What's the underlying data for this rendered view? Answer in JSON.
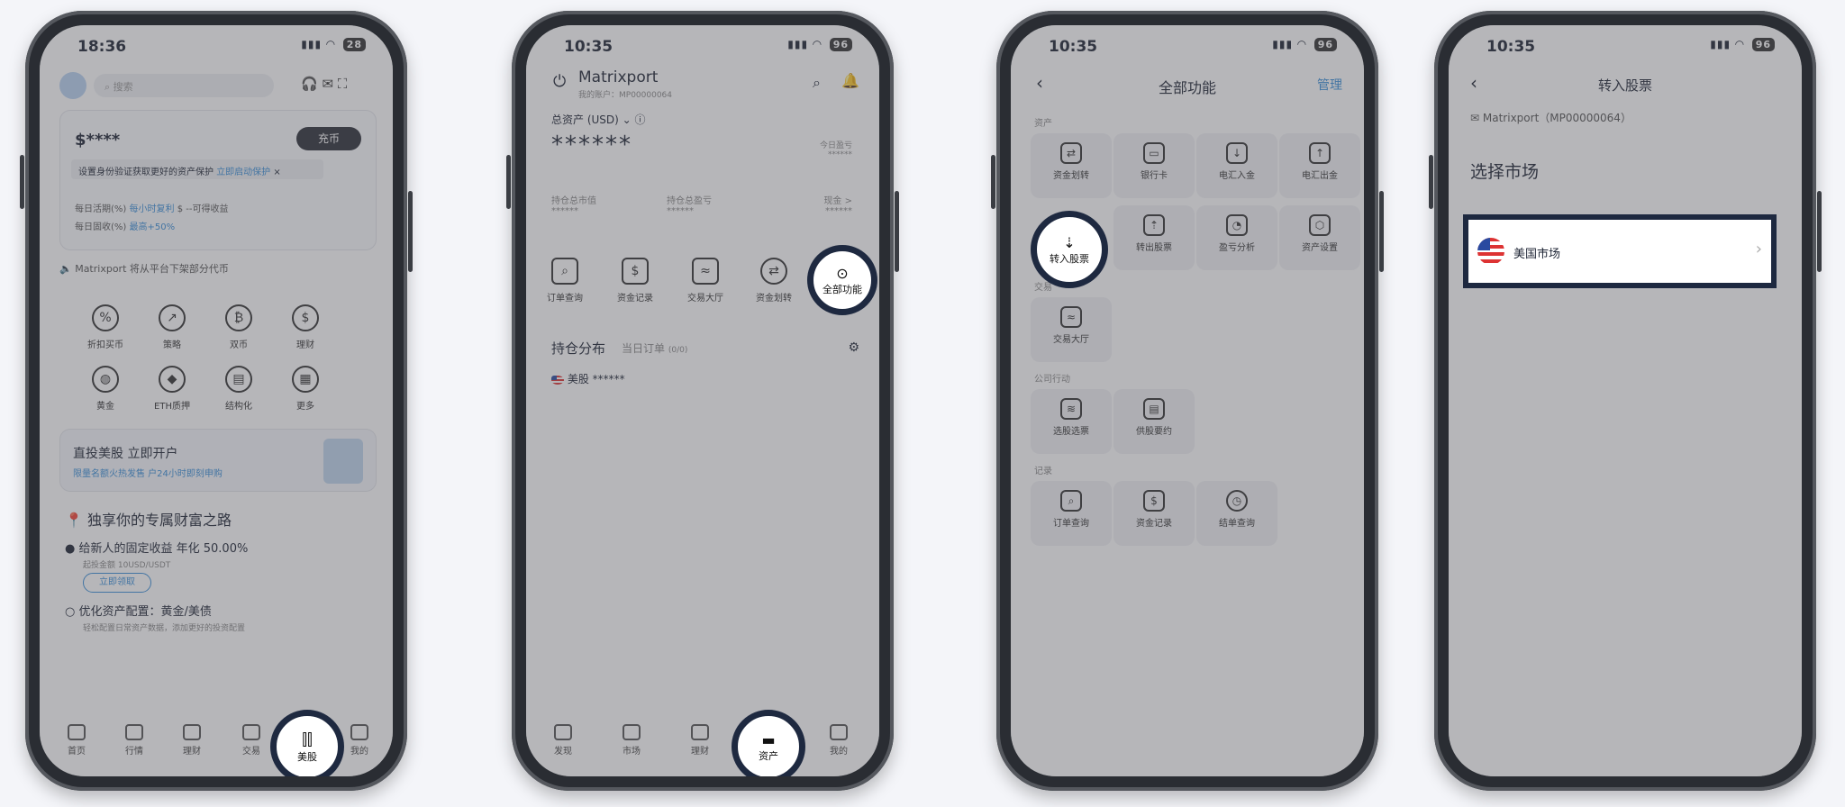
{
  "phone1": {
    "time": "18:36",
    "battery": "28",
    "search_placeholder": "搜索",
    "balance": "$****",
    "deposit": "充币",
    "kyc_text": "设置身份验证获取更好的资产保护",
    "kyc_link": "立即启动保护",
    "daily": "每日活期(%)",
    "daily_link": "每小时复利",
    "daily_tail": "$ --可得收益",
    "daily_period": "每日固收(%)",
    "daily_period_link": "最高+50%",
    "notice": "Matrixport 将从平台下架部分代币",
    "icons": [
      "折扣买币",
      "策略",
      "双币",
      "理财",
      "黄金",
      "ETH质押",
      "结构化",
      "更多"
    ],
    "banner_title": "直投美股 立即开户",
    "banner_sub": "限量名额火热发售 户24小时即刻申购",
    "journey_title": "独享你的专属财富之路",
    "step1": "给新人的固定收益 年化 50.00%",
    "step1_sub": "起投金额 10USD/USDT",
    "step1_btn": "立即领取",
    "step2": "优化资产配置：黄金/美债",
    "step2_sub": "轻松配置日常资产数据，添加更好的投资配置",
    "tabs": [
      "首页",
      "行情",
      "理财",
      "交易",
      "我的"
    ],
    "highlight_tab": "美股"
  },
  "phone2": {
    "time": "10:35",
    "battery": "96",
    "app_name": "Matrixport",
    "account": "我的账户：MP00000064",
    "total_assets": "总资产 (USD)",
    "masked": "******",
    "today_pnl": "今日盈亏",
    "today_pnl_val": "******",
    "holding_value": "持仓总市值",
    "holding_value_val": "******",
    "holding_pnl": "持仓总盈亏",
    "holding_pnl_val": "******",
    "cash": "现金 >",
    "cash_val": "******",
    "actions": [
      "订单查询",
      "资金记录",
      "交易大厅",
      "资金划转"
    ],
    "all_functions": "全部功能",
    "holdings_tab": "持仓分布",
    "orders_tab": "当日订单",
    "orders_count": "(0/0)",
    "us_stock": "美股",
    "us_stock_val": "******",
    "tabs": [
      "发现",
      "市场",
      "理财",
      "我的"
    ],
    "highlight_tab": "资产"
  },
  "phone3": {
    "time": "10:35",
    "battery": "96",
    "title": "全部功能",
    "manage": "管理",
    "sec_assets": "资产",
    "assets": [
      "资金划转",
      "银行卡",
      "电汇入金",
      "电汇出金",
      "转入股票",
      "转出股票",
      "盈亏分析",
      "资产设置"
    ],
    "sec_trade": "交易",
    "trade": [
      "交易大厅"
    ],
    "sec_corp": "公司行动",
    "corp": [
      "选股选票",
      "供股要约"
    ],
    "sec_record": "记录",
    "record": [
      "订单查询",
      "资金记录",
      "结单查询"
    ]
  },
  "phone4": {
    "time": "10:35",
    "battery": "96",
    "title": "转入股票",
    "account": "Matrixport（MP00000064）",
    "choose": "选择市场",
    "market": "美国市场"
  }
}
